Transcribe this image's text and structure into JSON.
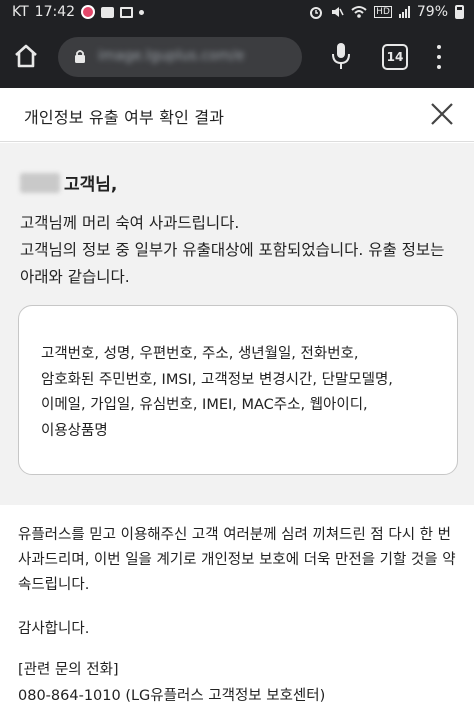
{
  "status_bar": {
    "carrier": "KT",
    "time": "17:42",
    "battery": "79%",
    "network_badge": "HD"
  },
  "browser": {
    "url": "image.lguplus.com/e",
    "tab_count": "14"
  },
  "page": {
    "header_title": "개인정보 유출 여부 확인 결과",
    "customer_suffix": "고객님,",
    "apology_text": "고객님께 머리 숙여 사과드립니다.\n고객님의 정보 중 일부가 유출대상에 포함되었습니다. 유출 정보는 아래와 같습니다.",
    "leaked_items_text": "고객번호, 성명, 우편번호, 주소, 생년월일, 전화번호,\n암호화된 주민번호, IMSI, 고객정보 변경시간, 단말모델명,\n이메일, 가입일, 유심번호, IMEI, MAC주소, 웹아이디,\n이용상품명",
    "closing_text": "유플러스를 믿고 이용해주신 고객 여러분께 심려 끼쳐드린 점 다시 한 번 사과드리며, 이번 일을 계기로 개인정보 보호에 더욱 만전을 기할 것을 약속드립니다.",
    "thanks": "감사합니다.",
    "contact_label": "[관련 문의 전화]",
    "contact_phone": "080-864-1010 (LG유플러스 고객정보 보호센터)"
  },
  "icons": {
    "home": "home-icon",
    "lock": "lock-icon",
    "mic": "microphone-icon",
    "menu": "more-vert-icon",
    "close": "close-icon"
  },
  "colors": {
    "chrome_bg": "#202124",
    "notice_bg": "#f2f2f2",
    "notification_dot": "#e3486a"
  }
}
